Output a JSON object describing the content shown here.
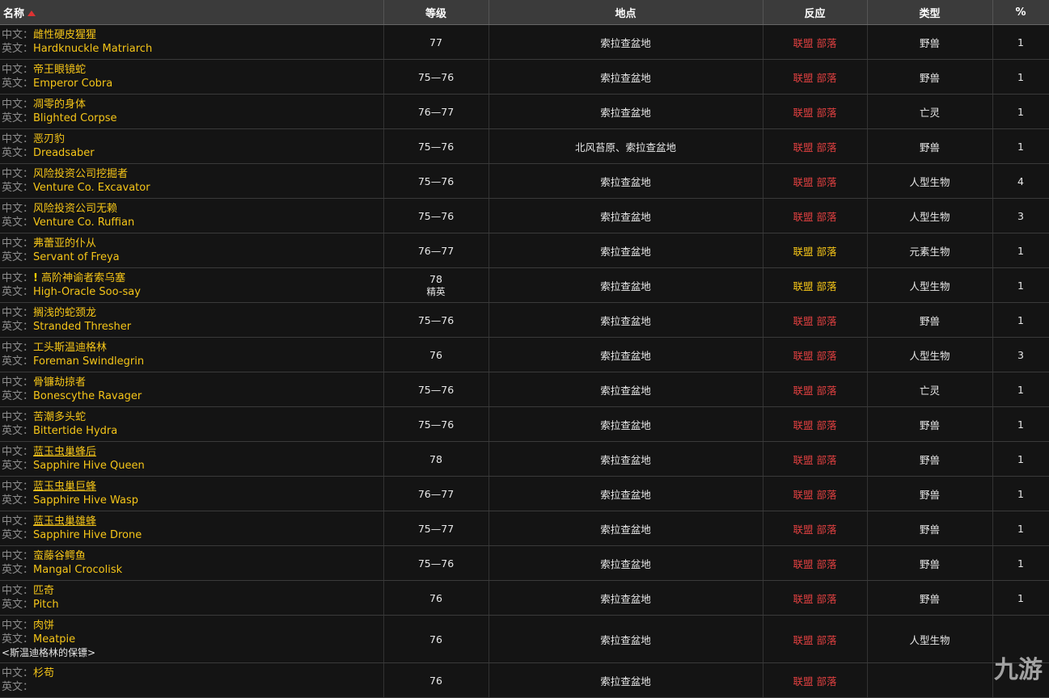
{
  "header": {
    "name": "名称",
    "level": "等级",
    "location": "地点",
    "reaction": "反应",
    "type": "类型",
    "percent": "%"
  },
  "labels": {
    "zh": "中文：",
    "en": "英文："
  },
  "rows": [
    {
      "zh": "雌性硬皮猩猩",
      "en": "Hardknuckle Matriarch",
      "level": "77",
      "location": "索拉查盆地",
      "reaction": "联盟 部落",
      "reaction_color": "red",
      "type": "野兽",
      "pct": "1"
    },
    {
      "zh": "帝王眼镜蛇",
      "en": "Emperor Cobra",
      "level": "75—76",
      "location": "索拉查盆地",
      "reaction": "联盟 部落",
      "reaction_color": "red",
      "type": "野兽",
      "pct": "1"
    },
    {
      "zh": "凋零的身体",
      "en": "Blighted Corpse",
      "level": "76—77",
      "location": "索拉查盆地",
      "reaction": "联盟 部落",
      "reaction_color": "red",
      "type": "亡灵",
      "pct": "1"
    },
    {
      "zh": "恶刃豹",
      "en": "Dreadsaber",
      "level": "75—76",
      "location": "北风苔原、索拉查盆地",
      "reaction": "联盟 部落",
      "reaction_color": "red",
      "type": "野兽",
      "pct": "1"
    },
    {
      "zh": "风险投资公司挖掘者",
      "en": "Venture Co. Excavator",
      "level": "75—76",
      "location": "索拉查盆地",
      "reaction": "联盟 部落",
      "reaction_color": "red",
      "type": "人型生物",
      "pct": "4"
    },
    {
      "zh": "风险投资公司无赖",
      "en": "Venture Co. Ruffian",
      "level": "75—76",
      "location": "索拉查盆地",
      "reaction": "联盟 部落",
      "reaction_color": "red",
      "type": "人型生物",
      "pct": "3"
    },
    {
      "zh": "弗蕾亚的仆从",
      "en": "Servant of Freya",
      "level": "76—77",
      "location": "索拉查盆地",
      "reaction": "联盟 部落",
      "reaction_color": "yellow",
      "type": "元素生物",
      "pct": "1"
    },
    {
      "zh": "高阶神谕者索乌塞",
      "en": "High-Oracle Soo-say",
      "level": "78",
      "level_sub": "精英",
      "excl": "!",
      "location": "索拉查盆地",
      "reaction": "联盟 部落",
      "reaction_color": "yellow",
      "type": "人型生物",
      "pct": "1"
    },
    {
      "zh": "搁浅的蛇颈龙",
      "en": "Stranded Thresher",
      "level": "75—76",
      "location": "索拉查盆地",
      "reaction": "联盟 部落",
      "reaction_color": "red",
      "type": "野兽",
      "pct": "1"
    },
    {
      "zh": "工头斯温迪格林",
      "en": "Foreman Swindlegrin",
      "level": "76",
      "location": "索拉查盆地",
      "reaction": "联盟 部落",
      "reaction_color": "red",
      "type": "人型生物",
      "pct": "3"
    },
    {
      "zh": "骨镰劫掠者",
      "en": "Bonescythe Ravager",
      "level": "75—76",
      "location": "索拉查盆地",
      "reaction": "联盟 部落",
      "reaction_color": "red",
      "type": "亡灵",
      "pct": "1"
    },
    {
      "zh": "苦潮多头蛇",
      "en": "Bittertide Hydra",
      "level": "75—76",
      "location": "索拉查盆地",
      "reaction": "联盟 部落",
      "reaction_color": "red",
      "type": "野兽",
      "pct": "1"
    },
    {
      "zh": "蓝玉虫巢蜂后",
      "en": "Sapphire Hive Queen",
      "level": "78",
      "location": "索拉查盆地",
      "reaction": "联盟 部落",
      "reaction_color": "red",
      "type": "野兽",
      "pct": "1",
      "underline": true
    },
    {
      "zh": "蓝玉虫巢巨蜂",
      "en": "Sapphire Hive Wasp",
      "level": "76—77",
      "location": "索拉查盆地",
      "reaction": "联盟 部落",
      "reaction_color": "red",
      "type": "野兽",
      "pct": "1",
      "underline": true
    },
    {
      "zh": "蓝玉虫巢雄蜂",
      "en": "Sapphire Hive Drone",
      "level": "75—77",
      "location": "索拉查盆地",
      "reaction": "联盟 部落",
      "reaction_color": "red",
      "type": "野兽",
      "pct": "1",
      "underline": true
    },
    {
      "zh": "蛮藤谷鳄鱼",
      "en": "Mangal Crocolisk",
      "level": "75—76",
      "location": "索拉查盆地",
      "reaction": "联盟 部落",
      "reaction_color": "red",
      "type": "野兽",
      "pct": "1"
    },
    {
      "zh": "匹奇",
      "en": "Pitch",
      "level": "76",
      "location": "索拉查盆地",
      "reaction": "联盟 部落",
      "reaction_color": "red",
      "type": "野兽",
      "pct": "1"
    },
    {
      "zh": "肉饼",
      "en": "Meatpie",
      "subtitle": "<斯温迪格林的保镖>",
      "level": "76",
      "location": "索拉查盆地",
      "reaction": "联盟 部落",
      "reaction_color": "red",
      "type": "人型生物",
      "pct": ""
    },
    {
      "zh": "杉苟",
      "en": "",
      "level": "76",
      "location": "索拉查盆地",
      "reaction": "联盟 部落",
      "reaction_color": "red",
      "type": "",
      "pct": ""
    }
  ],
  "watermark": "九游",
  "colors": {
    "header_bg": "#3b3b3b",
    "row_bg": "#141414",
    "name_text": "#f5c518",
    "hostile": "#e04040",
    "neutral": "#f5c518"
  },
  "sort_icon": "sort-up-icon"
}
